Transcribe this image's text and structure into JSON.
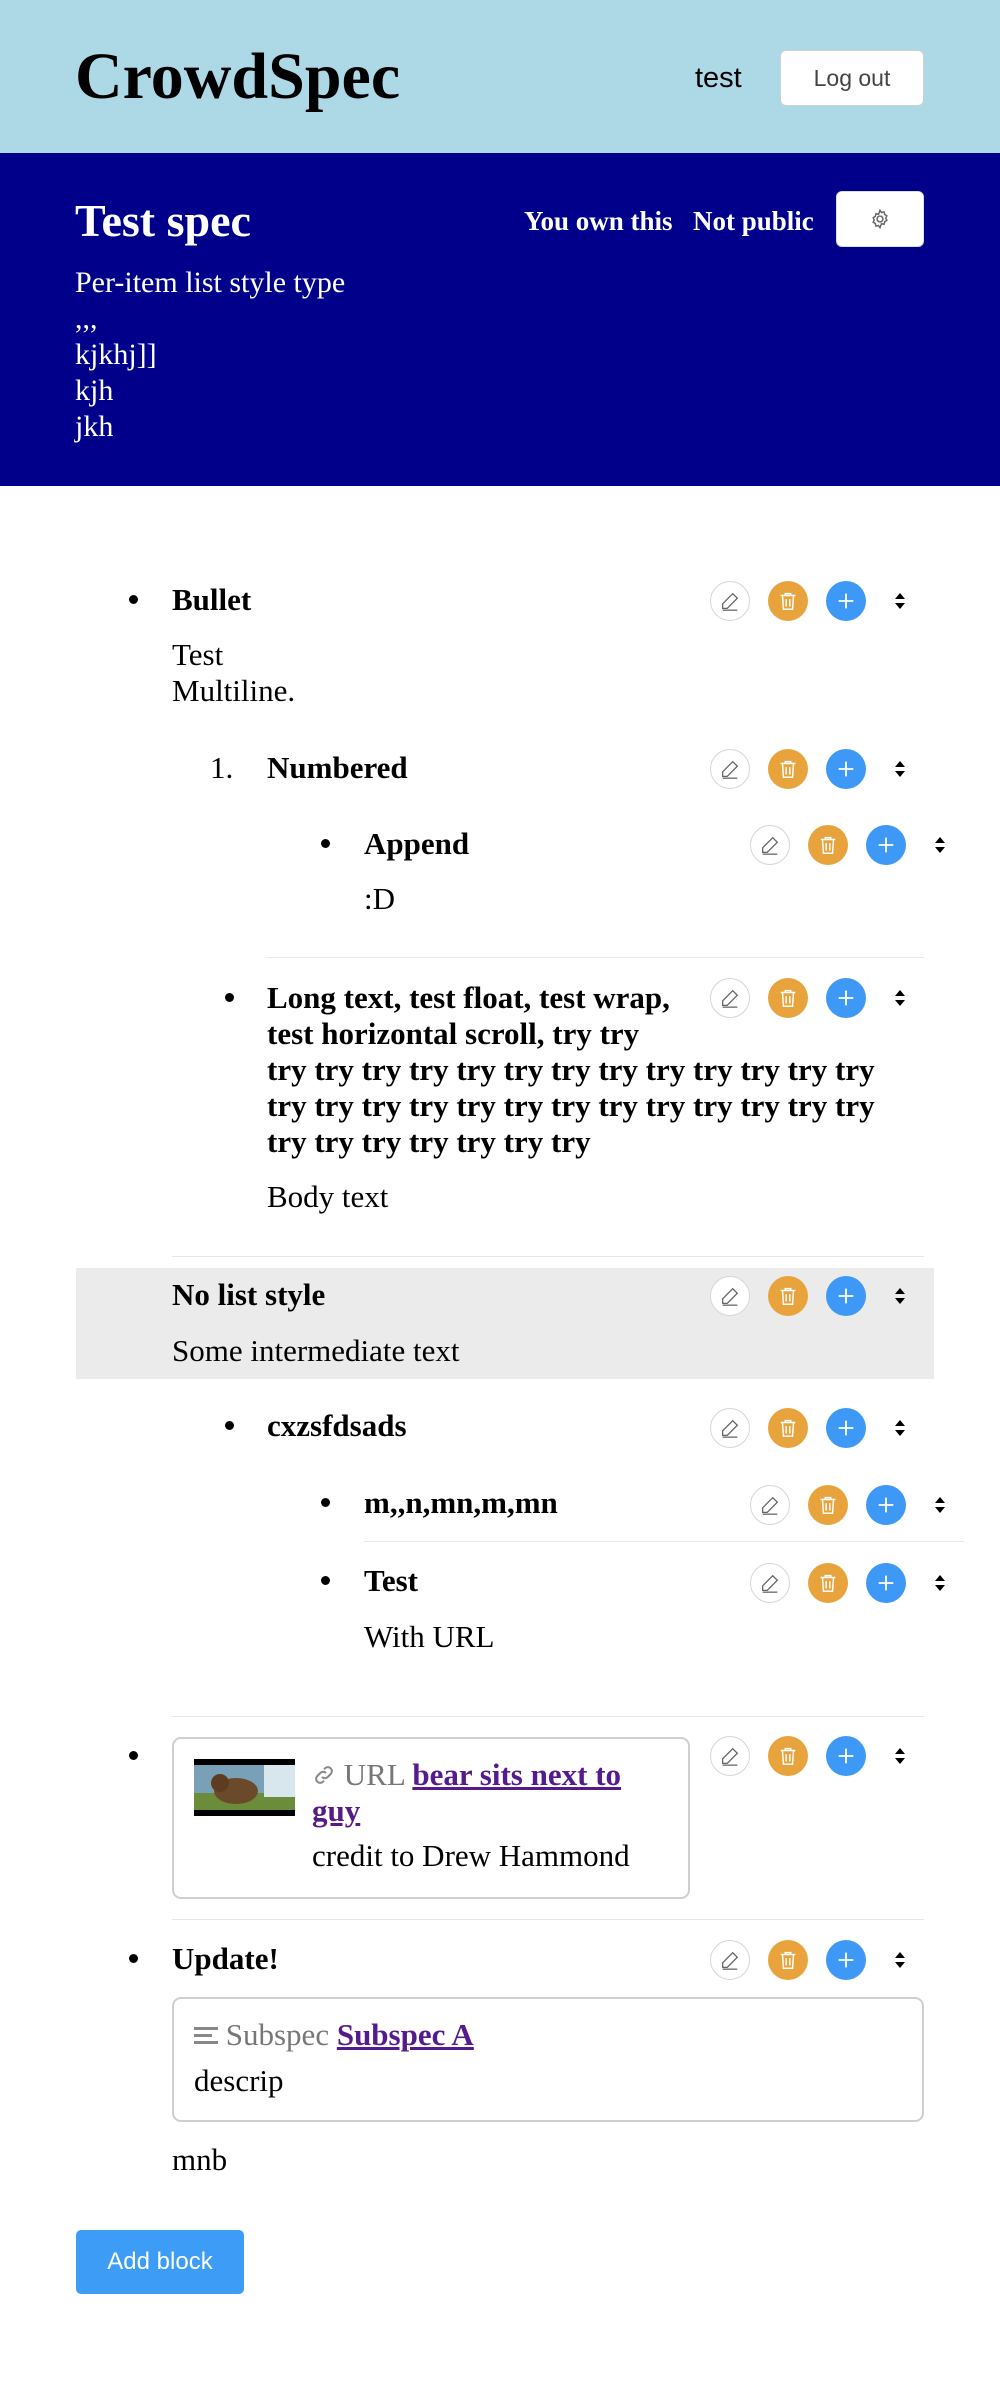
{
  "app": {
    "title": "CrowdSpec",
    "username": "test",
    "logout_label": "Log out"
  },
  "spec": {
    "title": "Test spec",
    "owner_label": "You own this",
    "visibility_label": "Not public",
    "description": "Per-item list style type\n,,,\nkjkhj]]\nkjh\njkh"
  },
  "blocks": {
    "bullet": {
      "title": "Bullet",
      "body": "Test\nMultiline."
    },
    "numbered": {
      "marker": "1.",
      "title": "Numbered"
    },
    "append": {
      "title": "Append",
      "body": ":D"
    },
    "long_text": {
      "title_line1": "Long text, test float, test wrap,",
      "title_line2": "test horizontal scroll, try try",
      "title_line3": "try try try try try try try try try try try try try",
      "title_line4": "try try try try try try try try try try try try try",
      "title_line5": "try try try try try try try",
      "body": "Body text"
    },
    "no_list_style": {
      "title": "No list style",
      "body": "Some intermediate text"
    },
    "cxzsfdsads": {
      "title": "cxzsfdsads"
    },
    "mn": {
      "title": "m,,n,mn,m,mn"
    },
    "test_url": {
      "title": "Test",
      "body": "With URL"
    },
    "url_block": {
      "type_label": "URL",
      "link_line1": "bear sits next to",
      "link_line2": "guy",
      "credit": "credit to Drew Hammond"
    },
    "update": {
      "title": "Update!",
      "subspec_type_label": "Subspec",
      "subspec_link": "Subspec A",
      "subspec_desc": "descrip",
      "body": "mnb"
    }
  },
  "add_block_label": "Add block",
  "colors": {
    "topbar": "#add8e6",
    "header": "#00008b",
    "edit": "#ffffff",
    "delete": "#e8a33d",
    "add": "#3d99f5",
    "highlight": "#ebebeb"
  },
  "icons": [
    "gear-icon",
    "pencil-icon",
    "trash-icon",
    "plus-icon",
    "sort-icon",
    "link-icon",
    "lines-icon"
  ]
}
